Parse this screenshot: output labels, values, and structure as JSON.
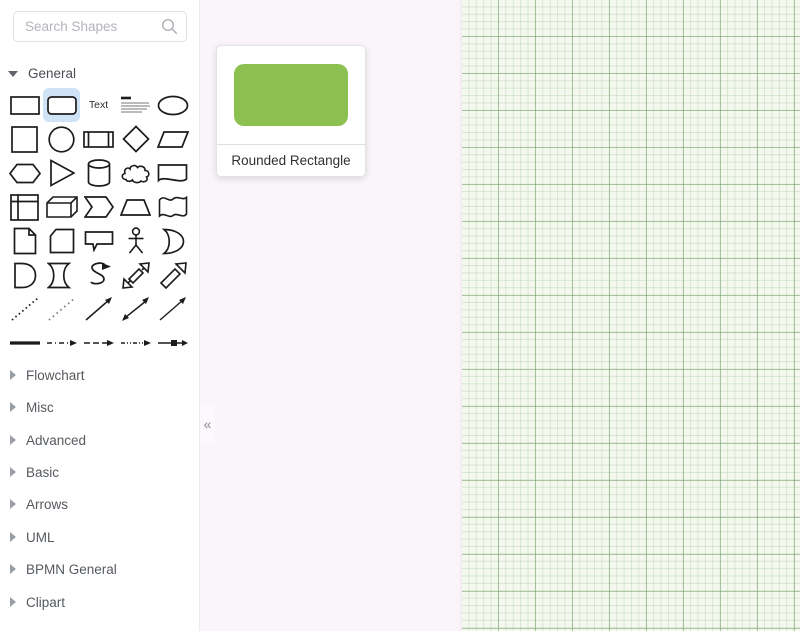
{
  "search": {
    "placeholder": "Search Shapes",
    "value": "",
    "icon": "search-icon"
  },
  "sections": {
    "expanded": {
      "label": "General",
      "caret": "caret-down-icon",
      "expanded": true
    },
    "collapsed": [
      {
        "label": "Flowchart",
        "caret": "caret-right-icon",
        "expanded": false
      },
      {
        "label": "Misc",
        "caret": "caret-right-icon",
        "expanded": false
      },
      {
        "label": "Advanced",
        "caret": "caret-right-icon",
        "expanded": false
      },
      {
        "label": "Basic",
        "caret": "caret-right-icon",
        "expanded": false
      },
      {
        "label": "Arrows",
        "caret": "caret-right-icon",
        "expanded": false
      },
      {
        "label": "UML",
        "caret": "caret-right-icon",
        "expanded": false
      },
      {
        "label": "BPMN General",
        "caret": "caret-right-icon",
        "expanded": false
      },
      {
        "label": "Clipart",
        "caret": "caret-right-icon",
        "expanded": false
      }
    ]
  },
  "palette": {
    "rows": [
      [
        {
          "name": "rectangle",
          "selected": false
        },
        {
          "name": "rounded-rectangle",
          "selected": true
        },
        {
          "name": "text",
          "selected": false,
          "text": "Text"
        },
        {
          "name": "textbox",
          "selected": false
        },
        {
          "name": "ellipse",
          "selected": false
        }
      ],
      [
        {
          "name": "square",
          "selected": false
        },
        {
          "name": "circle",
          "selected": false
        },
        {
          "name": "process",
          "selected": false
        },
        {
          "name": "diamond",
          "selected": false
        },
        {
          "name": "parallelogram",
          "selected": false
        }
      ],
      [
        {
          "name": "hexagon",
          "selected": false
        },
        {
          "name": "triangle",
          "selected": false
        },
        {
          "name": "cylinder",
          "selected": false
        },
        {
          "name": "cloud",
          "selected": false
        },
        {
          "name": "document",
          "selected": false
        }
      ],
      [
        {
          "name": "internal-storage",
          "selected": false
        },
        {
          "name": "cube",
          "selected": false
        },
        {
          "name": "step",
          "selected": false
        },
        {
          "name": "trapezoid",
          "selected": false
        },
        {
          "name": "tape",
          "selected": false
        }
      ],
      [
        {
          "name": "note",
          "selected": false
        },
        {
          "name": "card",
          "selected": false
        },
        {
          "name": "callout",
          "selected": false
        },
        {
          "name": "actor",
          "selected": false
        },
        {
          "name": "or",
          "selected": false
        }
      ],
      [
        {
          "name": "and",
          "selected": false
        },
        {
          "name": "data-storage",
          "selected": false
        },
        {
          "name": "curved-arrow",
          "selected": false
        },
        {
          "name": "bidirectional-arrow",
          "selected": false
        },
        {
          "name": "block-arrow",
          "selected": false
        }
      ],
      [
        {
          "name": "dotted-line",
          "selected": false
        },
        {
          "name": "dashed-line-2",
          "selected": false
        },
        {
          "name": "directional-connector",
          "selected": false
        },
        {
          "name": "bidirectional-connector",
          "selected": false
        },
        {
          "name": "arrow-connector",
          "selected": false
        }
      ],
      [
        {
          "name": "thick-line",
          "selected": false
        },
        {
          "name": "dash-dot-arrow",
          "selected": false
        },
        {
          "name": "dashed-arrow",
          "selected": false
        },
        {
          "name": "dash-dot-dot-arrow",
          "selected": false
        },
        {
          "name": "link-edge",
          "selected": false
        }
      ]
    ]
  },
  "preview": {
    "title": "Rounded Rectangle",
    "shape_color": "#8CC152"
  },
  "collapse_handle": {
    "glyph": "«"
  },
  "colors": {
    "sidebar_bg": "#FFFFFF",
    "middle_panel_bg": "#FAF5FA",
    "canvas_bg": "#F4F8EF",
    "selection_highlight": "#CFE3F7",
    "grid_major": "#78A06E",
    "grid_minor": "#96BE8C"
  }
}
